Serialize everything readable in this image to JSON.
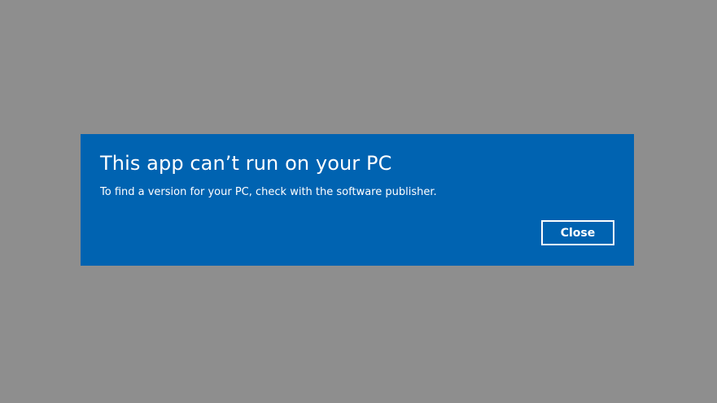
{
  "dialog": {
    "title": "This app can’t run on your PC",
    "message": "To find a version for your PC, check with the software publisher.",
    "close_label": "Close"
  },
  "colors": {
    "backdrop": "#8e8e8e",
    "dialog_background": "#0063b1",
    "text": "#ffffff",
    "button_border": "#ffffff"
  }
}
